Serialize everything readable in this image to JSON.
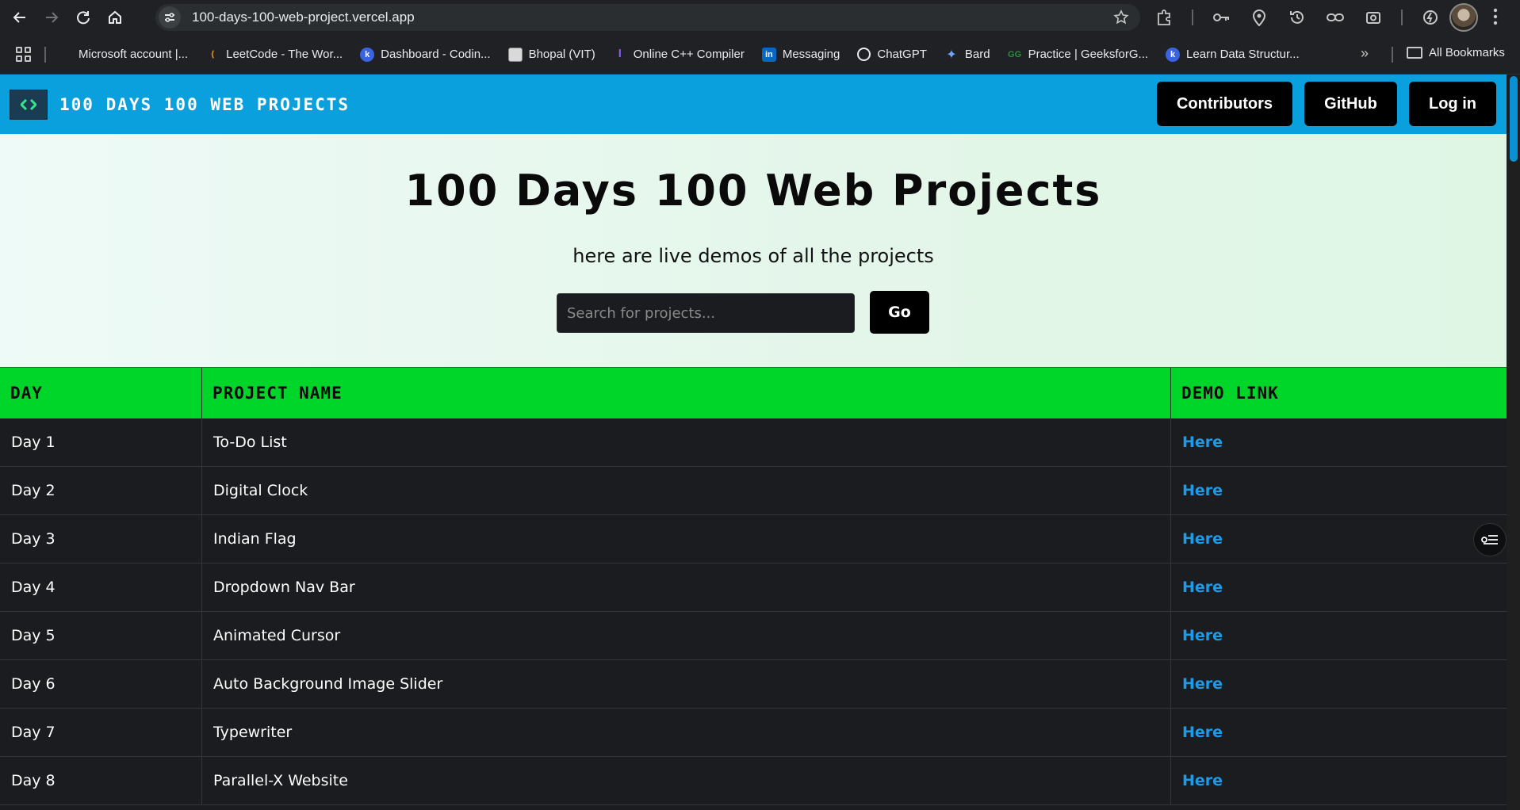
{
  "browser": {
    "url": "100-days-100-web-project.vercel.app",
    "bookmarks": [
      {
        "label": "Microsoft account |...",
        "icon": "microsoft-icon"
      },
      {
        "label": "LeetCode - The Wor...",
        "icon": "leetcode-icon"
      },
      {
        "label": "Dashboard - Codin...",
        "icon": "codingninjas-icon"
      },
      {
        "label": "Bhopal (VIT)",
        "icon": "page-icon"
      },
      {
        "label": "Online C++ Compiler",
        "icon": "compiler-icon"
      },
      {
        "label": "Messaging",
        "icon": "linkedin-icon"
      },
      {
        "label": "ChatGPT",
        "icon": "chatgpt-icon"
      },
      {
        "label": "Bard",
        "icon": "bard-icon"
      },
      {
        "label": "Practice | GeeksforG...",
        "icon": "geeksforgeeks-icon"
      },
      {
        "label": "Learn Data Structur...",
        "icon": "codingninjas-icon"
      }
    ],
    "all_bookmarks_label": "All Bookmarks"
  },
  "site": {
    "brand": "100 DAYS 100 WEB PROJECTS",
    "nav": {
      "contributors": "Contributors",
      "github": "GitHub",
      "login": "Log in"
    },
    "hero": {
      "title": "100 Days 100 Web Projects",
      "subtitle": "here are live demos of all the projects",
      "search_placeholder": "Search for projects...",
      "go_label": "Go"
    },
    "table": {
      "headers": [
        "DAY",
        "PROJECT NAME",
        "DEMO LINK"
      ],
      "rows": [
        {
          "day": "Day 1",
          "name": "To-Do List",
          "link": "Here"
        },
        {
          "day": "Day 2",
          "name": "Digital Clock",
          "link": "Here"
        },
        {
          "day": "Day 3",
          "name": "Indian Flag",
          "link": "Here"
        },
        {
          "day": "Day 4",
          "name": "Dropdown Nav Bar",
          "link": "Here"
        },
        {
          "day": "Day 5",
          "name": "Animated Cursor",
          "link": "Here"
        },
        {
          "day": "Day 6",
          "name": "Auto Background Image Slider",
          "link": "Here"
        },
        {
          "day": "Day 7",
          "name": "Typewriter",
          "link": "Here"
        },
        {
          "day": "Day 8",
          "name": "Parallel-X Website",
          "link": "Here"
        }
      ]
    }
  },
  "colors": {
    "navbar": "#0aa0dd",
    "table_header": "#00d62a",
    "link": "#1e9be6",
    "row_bg": "#1b1c1f"
  }
}
